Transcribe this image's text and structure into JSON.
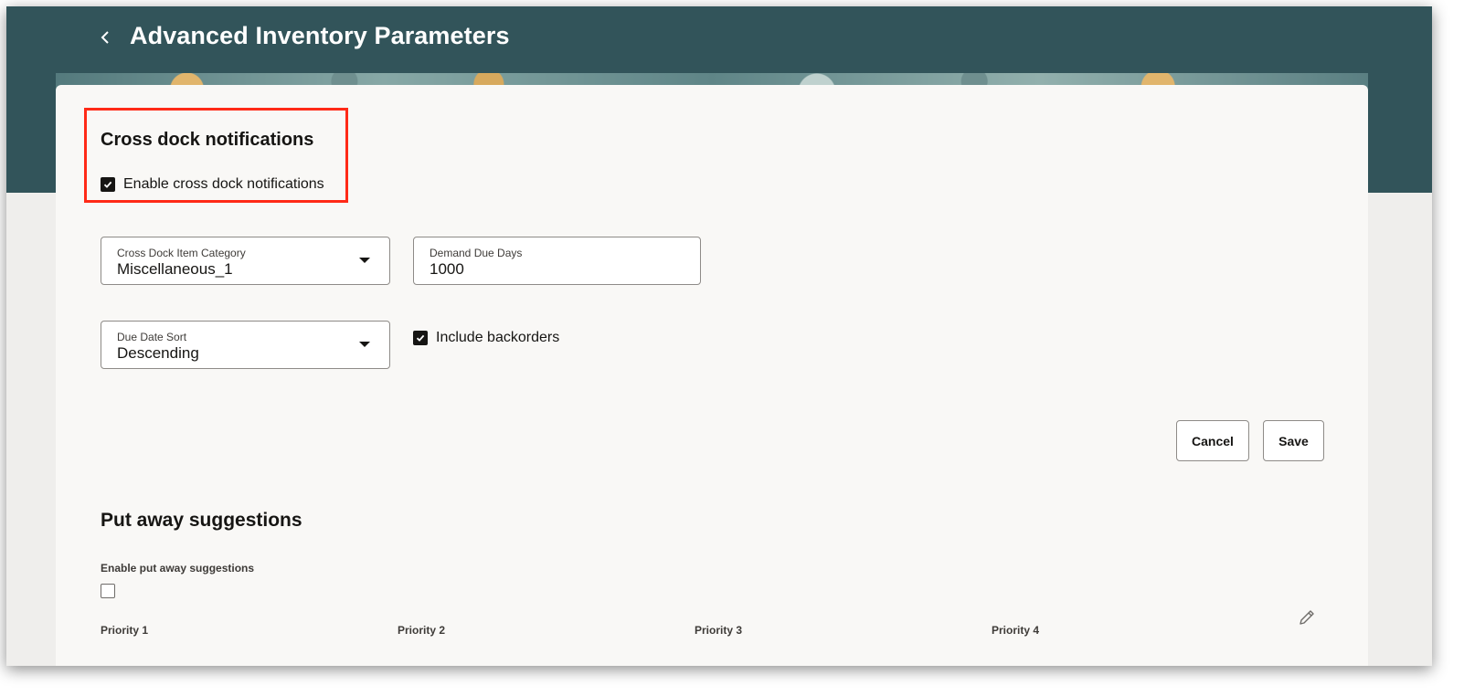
{
  "header": {
    "title": "Advanced Inventory Parameters"
  },
  "cross_dock": {
    "section_title": "Cross dock notifications",
    "enable_label": "Enable cross dock notifications",
    "enable_checked": true,
    "item_category": {
      "label": "Cross Dock Item Category",
      "value": "Miscellaneous_1"
    },
    "demand_due_days": {
      "label": "Demand Due Days",
      "value": "1000"
    },
    "due_date_sort": {
      "label": "Due Date Sort",
      "value": "Descending"
    },
    "include_backorders": {
      "label": "Include backorders",
      "checked": true
    }
  },
  "actions": {
    "cancel_label": "Cancel",
    "save_label": "Save"
  },
  "put_away": {
    "section_title": "Put away suggestions",
    "enable_label": "Enable put away suggestions",
    "enable_checked": false,
    "priorities": [
      "Priority 1",
      "Priority 2",
      "Priority 3",
      "Priority 4"
    ]
  },
  "colors": {
    "header_band": "#32545a",
    "card_background": "#f9f8f6",
    "highlight_border": "#ff2a17"
  },
  "icons": {
    "back": "chevron-left-icon",
    "dropdown": "caret-down-icon",
    "checkbox": "checkmark-icon",
    "edit": "pencil-icon"
  }
}
